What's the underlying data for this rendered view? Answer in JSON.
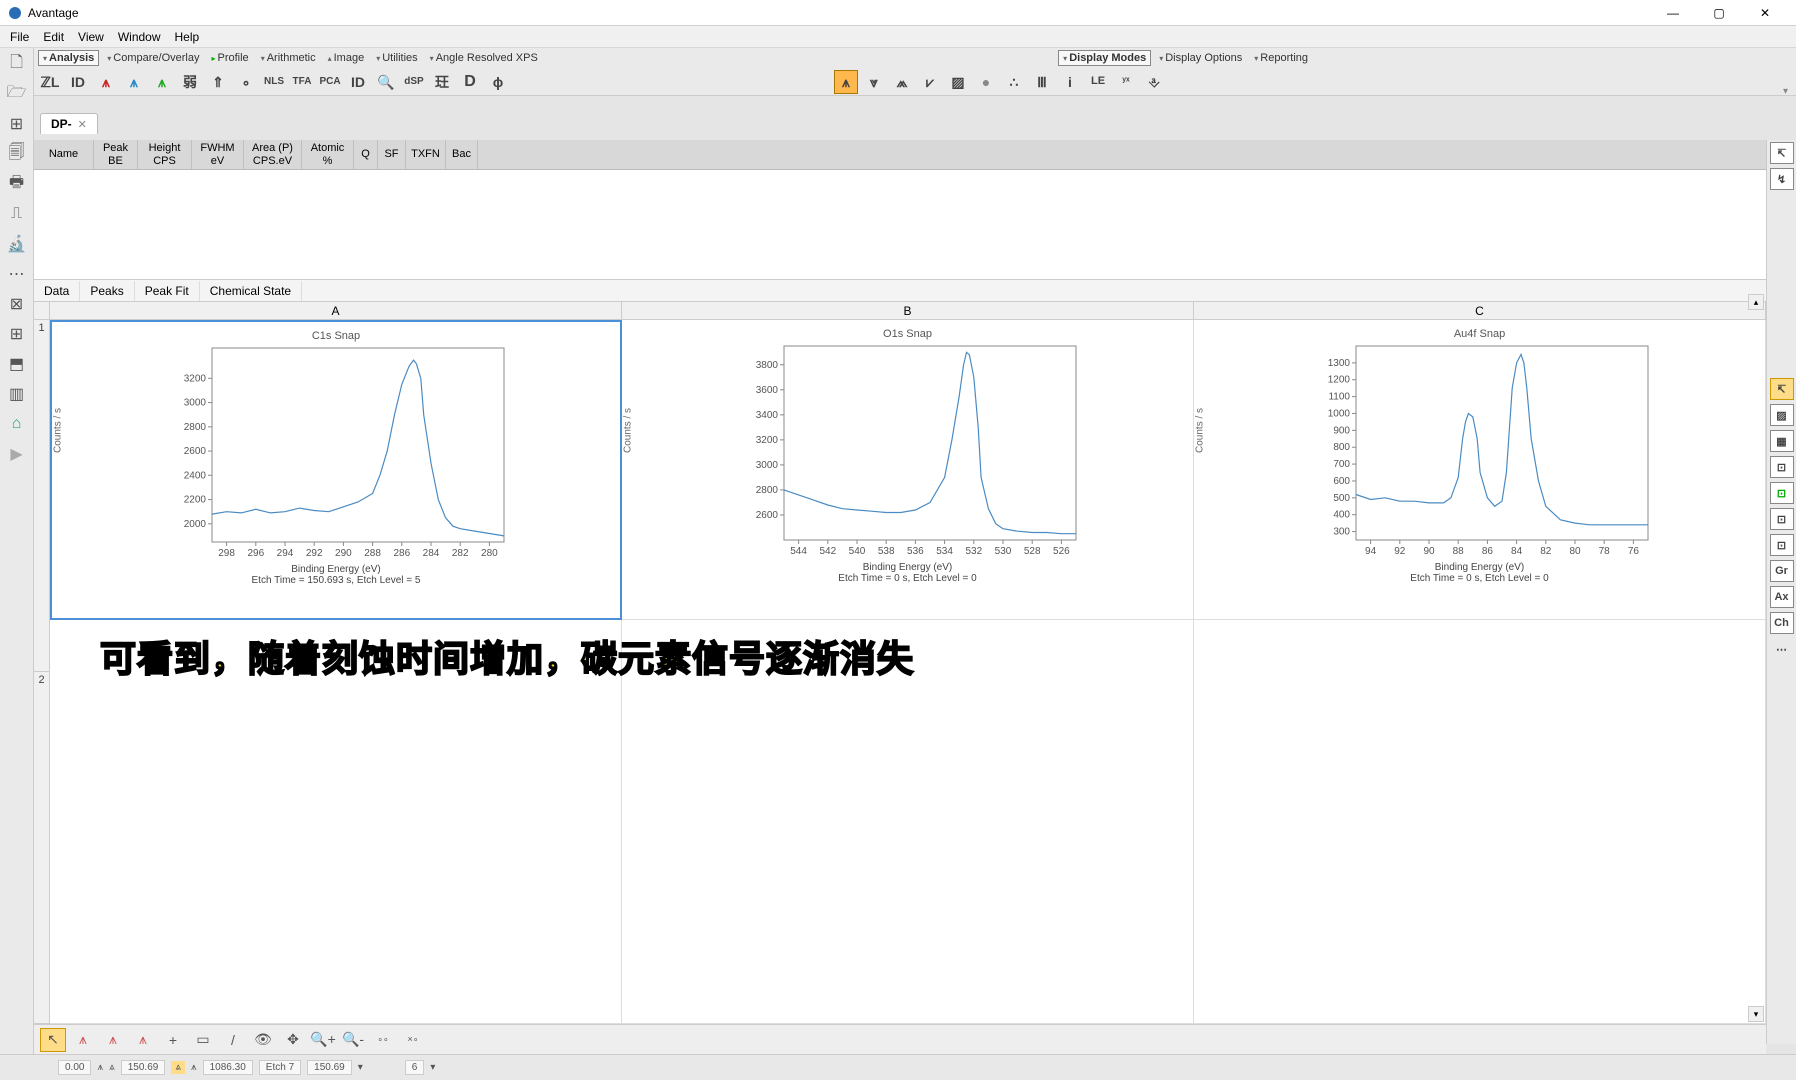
{
  "app_title": "Avantage",
  "window_controls": {
    "min": "—",
    "max": "▢",
    "close": "✕"
  },
  "menubar": [
    "File",
    "Edit",
    "View",
    "Window",
    "Help"
  ],
  "toolbar_groups_left": [
    {
      "label": "Analysis",
      "active": true
    },
    {
      "label": "Compare/Overlay"
    },
    {
      "label": "Profile"
    },
    {
      "label": "Arithmetic"
    },
    {
      "label": "Image"
    },
    {
      "label": "Utilities"
    },
    {
      "label": "Angle Resolved XPS"
    }
  ],
  "toolbar_groups_right": [
    {
      "label": "Display Modes",
      "active": true
    },
    {
      "label": "Display Options"
    },
    {
      "label": "Reporting"
    }
  ],
  "iconbar_left": [
    "ℤL",
    "ID",
    "⩚",
    "⩚",
    "⩚",
    "弱",
    "⇑",
    "∘",
    "NLS",
    "TFA",
    "PCA",
    "ID",
    "🔍",
    "dSP",
    "玨",
    "D",
    "ɸ"
  ],
  "iconbar_right": [
    "⩚",
    "⩔",
    "⩕",
    "⩗",
    "▨",
    "●",
    "∴",
    "Ⅲ",
    "i",
    "LE",
    "ʸˣ",
    "⎀"
  ],
  "leftbar_icons": [
    "🗋",
    "🗁",
    "⊞",
    "🗐",
    "🖶",
    "⎍",
    "🔬",
    "⋯",
    "⊠",
    "⊞",
    "⬒",
    "▥",
    "⌂",
    "▶"
  ],
  "rightbar_icons": [
    "↸",
    "↯",
    "↸",
    "▨",
    "▦",
    "⊡",
    "⊡",
    "⊡",
    "⊡",
    "Gr",
    "Ax",
    "Ch",
    "⋯"
  ],
  "doc_tab": "DP-",
  "table_headers": [
    {
      "l1": "Name",
      "l2": ""
    },
    {
      "l1": "Peak",
      "l2": "BE"
    },
    {
      "l1": "Height",
      "l2": "CPS"
    },
    {
      "l1": "FWHM",
      "l2": "eV"
    },
    {
      "l1": "Area (P)",
      "l2": "CPS.eV"
    },
    {
      "l1": "Atomic",
      "l2": "%"
    },
    {
      "l1": "Q",
      "l2": ""
    },
    {
      "l1": "SF",
      "l2": ""
    },
    {
      "l1": "TXFN",
      "l2": ""
    },
    {
      "l1": "Bac",
      "l2": ""
    }
  ],
  "sub_tabs": [
    "Data",
    "Peaks",
    "Peak Fit",
    "Chemical State"
  ],
  "col_headers": [
    "A",
    "B",
    "C"
  ],
  "row_headers": [
    "1",
    "2"
  ],
  "overlay_caption": "可看到，随着刻蚀时间增加，碳元素信号逐渐消失",
  "bottom_icons": [
    "↖",
    "⩚",
    "⩚",
    "⩚",
    "+",
    "▭",
    "/",
    "👁",
    "✥",
    "🔍+",
    "🔍-",
    "∘∘",
    "×∘"
  ],
  "statusbar": {
    "v0": "0.00",
    "v1": "150.69",
    "etch": "Etch 7",
    "v2": "1086.30",
    "v3": "150.69",
    "v4": "6"
  },
  "chart_data": [
    {
      "title": "C1s Snap",
      "ylabel": "Counts / s",
      "xlabel": "Binding Energy (eV)",
      "subtitle": "Etch Time = 150.693 s, Etch Level = 5",
      "type": "line",
      "x_ticks": [
        298,
        296,
        294,
        292,
        290,
        288,
        286,
        284,
        282,
        280
      ],
      "y_ticks": [
        2000,
        2200,
        2400,
        2600,
        2800,
        3000,
        3200
      ],
      "xlim": [
        299,
        279
      ],
      "ylim": [
        1850,
        3450
      ],
      "series": [
        {
          "name": "C1s",
          "color": "#4a8bc2",
          "x": [
            299,
            298,
            297,
            296,
            295,
            294,
            293,
            292,
            291,
            290,
            289,
            288,
            287.5,
            287,
            286.5,
            286,
            285.5,
            285.2,
            285,
            284.7,
            284.5,
            284,
            283.5,
            283,
            282.5,
            282,
            281,
            280,
            279
          ],
          "y": [
            2080,
            2100,
            2090,
            2120,
            2090,
            2100,
            2130,
            2110,
            2100,
            2140,
            2180,
            2250,
            2400,
            2600,
            2900,
            3150,
            3300,
            3350,
            3320,
            3200,
            2900,
            2500,
            2200,
            2050,
            1980,
            1960,
            1940,
            1920,
            1900
          ]
        }
      ]
    },
    {
      "title": "O1s Snap",
      "ylabel": "Counts / s",
      "xlabel": "Binding Energy (eV)",
      "subtitle": "Etch Time = 0 s, Etch Level = 0",
      "type": "line",
      "x_ticks": [
        544,
        542,
        540,
        538,
        536,
        534,
        532,
        530,
        528,
        526
      ],
      "y_ticks": [
        2600,
        2800,
        3000,
        3200,
        3400,
        3600,
        3800
      ],
      "xlim": [
        545,
        525
      ],
      "ylim": [
        2400,
        3950
      ],
      "series": [
        {
          "name": "O1s",
          "color": "#4a8bc2",
          "x": [
            545,
            544,
            543,
            542,
            541,
            540,
            539,
            538,
            537,
            536,
            535,
            534,
            533.5,
            533,
            532.7,
            532.5,
            532.3,
            532,
            531.7,
            531.5,
            531,
            530.5,
            530,
            529,
            528,
            527,
            526,
            525
          ],
          "y": [
            2800,
            2760,
            2720,
            2680,
            2650,
            2640,
            2630,
            2620,
            2620,
            2640,
            2700,
            2900,
            3200,
            3550,
            3800,
            3900,
            3880,
            3700,
            3300,
            2900,
            2650,
            2530,
            2490,
            2470,
            2460,
            2460,
            2450,
            2450
          ]
        }
      ]
    },
    {
      "title": "Au4f Snap",
      "ylabel": "Counts / s",
      "xlabel": "Binding Energy (eV)",
      "subtitle": "Etch Time = 0 s, Etch Level = 0",
      "type": "line",
      "x_ticks": [
        94,
        92,
        90,
        88,
        86,
        84,
        82,
        80,
        78,
        76
      ],
      "y_ticks": [
        300,
        400,
        500,
        600,
        700,
        800,
        900,
        1000,
        1100,
        1200,
        1300
      ],
      "xlim": [
        95,
        75
      ],
      "ylim": [
        250,
        1400
      ],
      "series": [
        {
          "name": "Au4f",
          "color": "#4a8bc2",
          "x": [
            95,
            94,
            93,
            92,
            91,
            90,
            89,
            88.5,
            88,
            87.7,
            87.5,
            87.3,
            87,
            86.7,
            86.5,
            86,
            85.5,
            85,
            84.7,
            84.5,
            84.3,
            84,
            83.7,
            83.5,
            83.3,
            83,
            82.5,
            82,
            81,
            80,
            79,
            78,
            77,
            76,
            75
          ],
          "y": [
            520,
            490,
            500,
            480,
            480,
            470,
            470,
            500,
            620,
            850,
            950,
            1000,
            980,
            850,
            650,
            500,
            450,
            480,
            650,
            900,
            1150,
            1300,
            1350,
            1300,
            1150,
            850,
            600,
            450,
            370,
            350,
            340,
            340,
            340,
            340,
            340
          ]
        }
      ]
    }
  ]
}
